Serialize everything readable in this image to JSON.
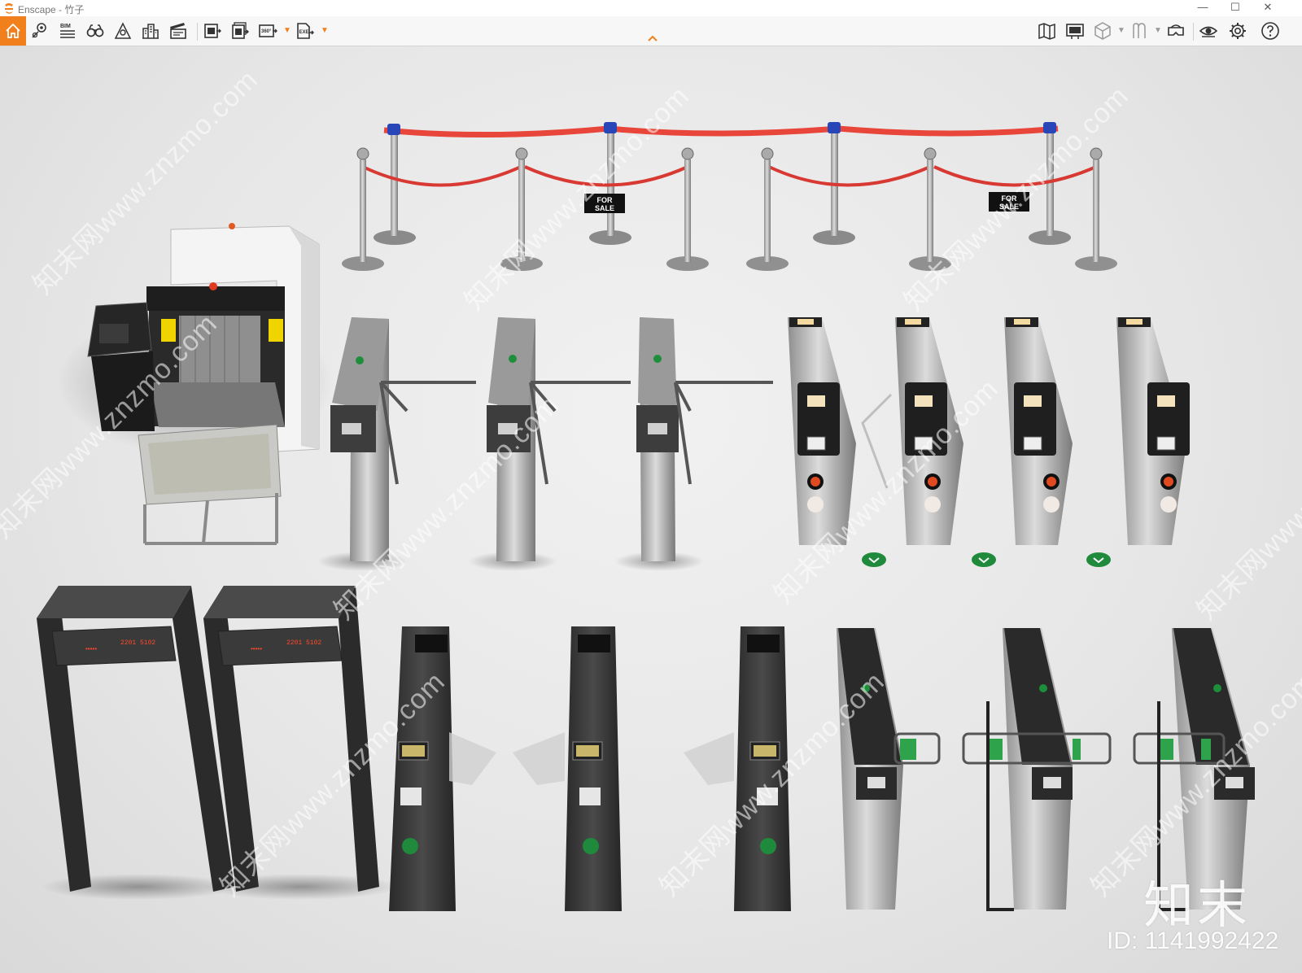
{
  "window": {
    "title": "Enscape - 竹子",
    "controls": {
      "minimize": "—",
      "maximize": "☐",
      "close": "✕"
    }
  },
  "toolbar": {
    "accent": "#f07f1c",
    "bim_label": "BIM",
    "video_label": "360°",
    "exe_label": "EXE",
    "left_icons": [
      "home-icon",
      "location-pin-icon",
      "bim-icon",
      "binoculars-icon",
      "sun-path-icon",
      "buildings-icon",
      "clapperboard-icon",
      "screenshot-export-icon",
      "batch-export-icon",
      "panorama-360-icon",
      "exe-export-icon"
    ],
    "right_icons": [
      "map-icon",
      "billboard-icon",
      "cube-icon",
      "asset-library-icon",
      "vr-headset-icon",
      "eye-icon",
      "gear-icon",
      "help-icon"
    ]
  },
  "scene": {
    "signs": [
      "FOR\nSALE",
      "FOR\nSALE"
    ],
    "sign_lines": [
      "FOR",
      "SALE"
    ],
    "detector_readout": "2201 5102",
    "led_dots": "•••••"
  },
  "watermark": {
    "text": "知末网www.znzmo.com",
    "logo": "知末",
    "id_text": "ID: 1141992422"
  }
}
